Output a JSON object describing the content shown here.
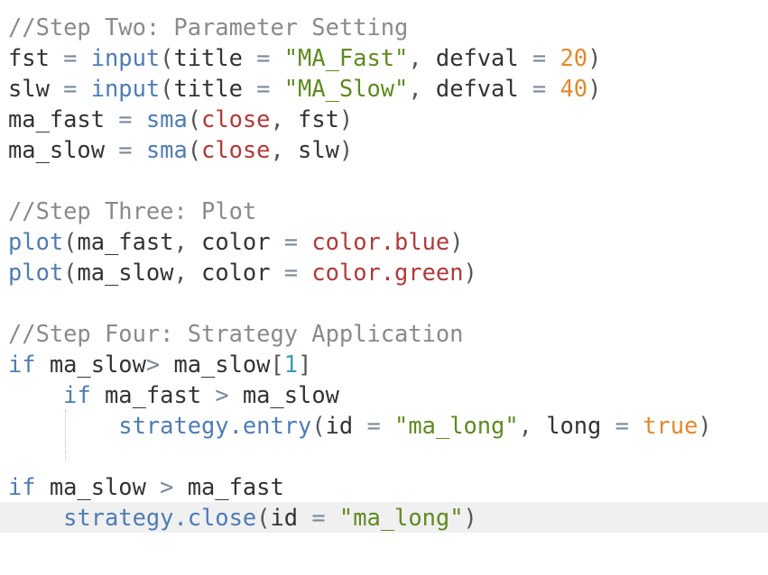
{
  "colors": {
    "background": "#ffffff",
    "highlight_line": "#f0f0f0",
    "comment": "#8a8a8a",
    "keyword": "#4f7cb3",
    "string": "#5f8a1f",
    "number": "#e08a2e",
    "builtin": "#b03a3a",
    "text": "#333333"
  },
  "editor": {
    "highlighted_line": 16,
    "lines": [
      {
        "tokens": [
          {
            "t": "comment",
            "v": "//Step Two: Parameter Setting"
          }
        ]
      },
      {
        "tokens": [
          {
            "t": "var",
            "v": "fst"
          },
          {
            "t": "op",
            "v": " = "
          },
          {
            "t": "func",
            "v": "input"
          },
          {
            "t": "punct",
            "v": "("
          },
          {
            "t": "var",
            "v": "title"
          },
          {
            "t": "op",
            "v": " = "
          },
          {
            "t": "string",
            "v": "\"MA_Fast\""
          },
          {
            "t": "punct",
            "v": ", "
          },
          {
            "t": "var",
            "v": "defval"
          },
          {
            "t": "op",
            "v": " = "
          },
          {
            "t": "number",
            "v": "20"
          },
          {
            "t": "punct",
            "v": ")"
          }
        ]
      },
      {
        "tokens": [
          {
            "t": "var",
            "v": "slw"
          },
          {
            "t": "op",
            "v": " = "
          },
          {
            "t": "func",
            "v": "input"
          },
          {
            "t": "punct",
            "v": "("
          },
          {
            "t": "var",
            "v": "title"
          },
          {
            "t": "op",
            "v": " = "
          },
          {
            "t": "string",
            "v": "\"MA_Slow\""
          },
          {
            "t": "punct",
            "v": ", "
          },
          {
            "t": "var",
            "v": "defval"
          },
          {
            "t": "op",
            "v": " = "
          },
          {
            "t": "number",
            "v": "40"
          },
          {
            "t": "punct",
            "v": ")"
          }
        ]
      },
      {
        "tokens": [
          {
            "t": "var",
            "v": "ma_fast"
          },
          {
            "t": "op",
            "v": " = "
          },
          {
            "t": "func",
            "v": "sma"
          },
          {
            "t": "punct",
            "v": "("
          },
          {
            "t": "builtin",
            "v": "close"
          },
          {
            "t": "punct",
            "v": ", "
          },
          {
            "t": "var",
            "v": "fst"
          },
          {
            "t": "punct",
            "v": ")"
          }
        ]
      },
      {
        "tokens": [
          {
            "t": "var",
            "v": "ma_slow"
          },
          {
            "t": "op",
            "v": " = "
          },
          {
            "t": "func",
            "v": "sma"
          },
          {
            "t": "punct",
            "v": "("
          },
          {
            "t": "builtin",
            "v": "close"
          },
          {
            "t": "punct",
            "v": ", "
          },
          {
            "t": "var",
            "v": "slw"
          },
          {
            "t": "punct",
            "v": ")"
          }
        ]
      },
      {
        "tokens": []
      },
      {
        "tokens": [
          {
            "t": "comment",
            "v": "//Step Three: Plot"
          }
        ]
      },
      {
        "tokens": [
          {
            "t": "func",
            "v": "plot"
          },
          {
            "t": "punct",
            "v": "("
          },
          {
            "t": "var",
            "v": "ma_fast"
          },
          {
            "t": "punct",
            "v": ", "
          },
          {
            "t": "var",
            "v": "color"
          },
          {
            "t": "op",
            "v": " = "
          },
          {
            "t": "builtin",
            "v": "color.blue"
          },
          {
            "t": "punct",
            "v": ")"
          }
        ]
      },
      {
        "tokens": [
          {
            "t": "func",
            "v": "plot"
          },
          {
            "t": "punct",
            "v": "("
          },
          {
            "t": "var",
            "v": "ma_slow"
          },
          {
            "t": "punct",
            "v": ", "
          },
          {
            "t": "var",
            "v": "color"
          },
          {
            "t": "op",
            "v": " = "
          },
          {
            "t": "builtin",
            "v": "color.green"
          },
          {
            "t": "punct",
            "v": ")"
          }
        ]
      },
      {
        "tokens": []
      },
      {
        "tokens": [
          {
            "t": "comment",
            "v": "//Step Four: Strategy Application"
          }
        ]
      },
      {
        "tokens": [
          {
            "t": "keyword",
            "v": "if"
          },
          {
            "t": "var",
            "v": " ma_slow"
          },
          {
            "t": "op",
            "v": "> "
          },
          {
            "t": "var",
            "v": "ma_slow"
          },
          {
            "t": "punct",
            "v": "["
          },
          {
            "t": "index",
            "v": "1"
          },
          {
            "t": "punct",
            "v": "]"
          }
        ]
      },
      {
        "tokens": [
          {
            "t": "var",
            "v": "    "
          },
          {
            "t": "keyword",
            "v": "if"
          },
          {
            "t": "var",
            "v": " ma_fast"
          },
          {
            "t": "op",
            "v": " > "
          },
          {
            "t": "var",
            "v": "ma_slow"
          }
        ]
      },
      {
        "tokens": [
          {
            "t": "var",
            "v": "        "
          },
          {
            "t": "func",
            "v": "strategy.entry"
          },
          {
            "t": "punct",
            "v": "("
          },
          {
            "t": "var",
            "v": "id"
          },
          {
            "t": "op",
            "v": " = "
          },
          {
            "t": "string",
            "v": "\"ma_long\""
          },
          {
            "t": "punct",
            "v": ", "
          },
          {
            "t": "var",
            "v": "long"
          },
          {
            "t": "op",
            "v": " = "
          },
          {
            "t": "bool",
            "v": "true"
          },
          {
            "t": "punct",
            "v": ")"
          }
        ]
      },
      {
        "tokens": []
      },
      {
        "tokens": [
          {
            "t": "keyword",
            "v": "if"
          },
          {
            "t": "var",
            "v": " ma_slow"
          },
          {
            "t": "op",
            "v": " > "
          },
          {
            "t": "var",
            "v": "ma_fast"
          }
        ]
      },
      {
        "tokens": [
          {
            "t": "var",
            "v": "    "
          },
          {
            "t": "func",
            "v": "strategy.close"
          },
          {
            "t": "punct",
            "v": "("
          },
          {
            "t": "var",
            "v": "id"
          },
          {
            "t": "op",
            "v": " = "
          },
          {
            "t": "string",
            "v": "\"ma_long\""
          },
          {
            "t": "punct",
            "v": ")"
          }
        ]
      }
    ]
  }
}
